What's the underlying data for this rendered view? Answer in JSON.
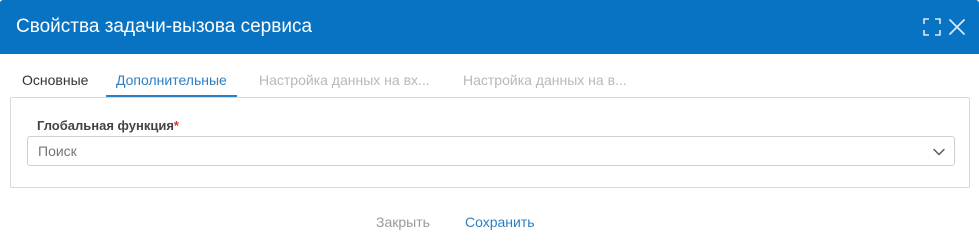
{
  "dialog": {
    "title": "Свойства задачи-вызова сервиса",
    "icons": {
      "maximize": "maximize-icon",
      "close": "close-icon"
    }
  },
  "tabs": [
    {
      "label": "Основные",
      "state": "normal"
    },
    {
      "label": "Дополнительные",
      "state": "active"
    },
    {
      "label": "Настройка данных на вх...",
      "state": "disabled"
    },
    {
      "label": "Настройка данных на в...",
      "state": "disabled"
    }
  ],
  "form": {
    "global_function": {
      "label": "Глобальная функция",
      "required_mark": "*",
      "placeholder": "Поиск"
    }
  },
  "footer": {
    "close_label": "Закрыть",
    "save_label": "Сохранить"
  },
  "colors": {
    "titlebar": "#0873c2",
    "accent": "#2c7fc2",
    "required": "#d9342b"
  }
}
